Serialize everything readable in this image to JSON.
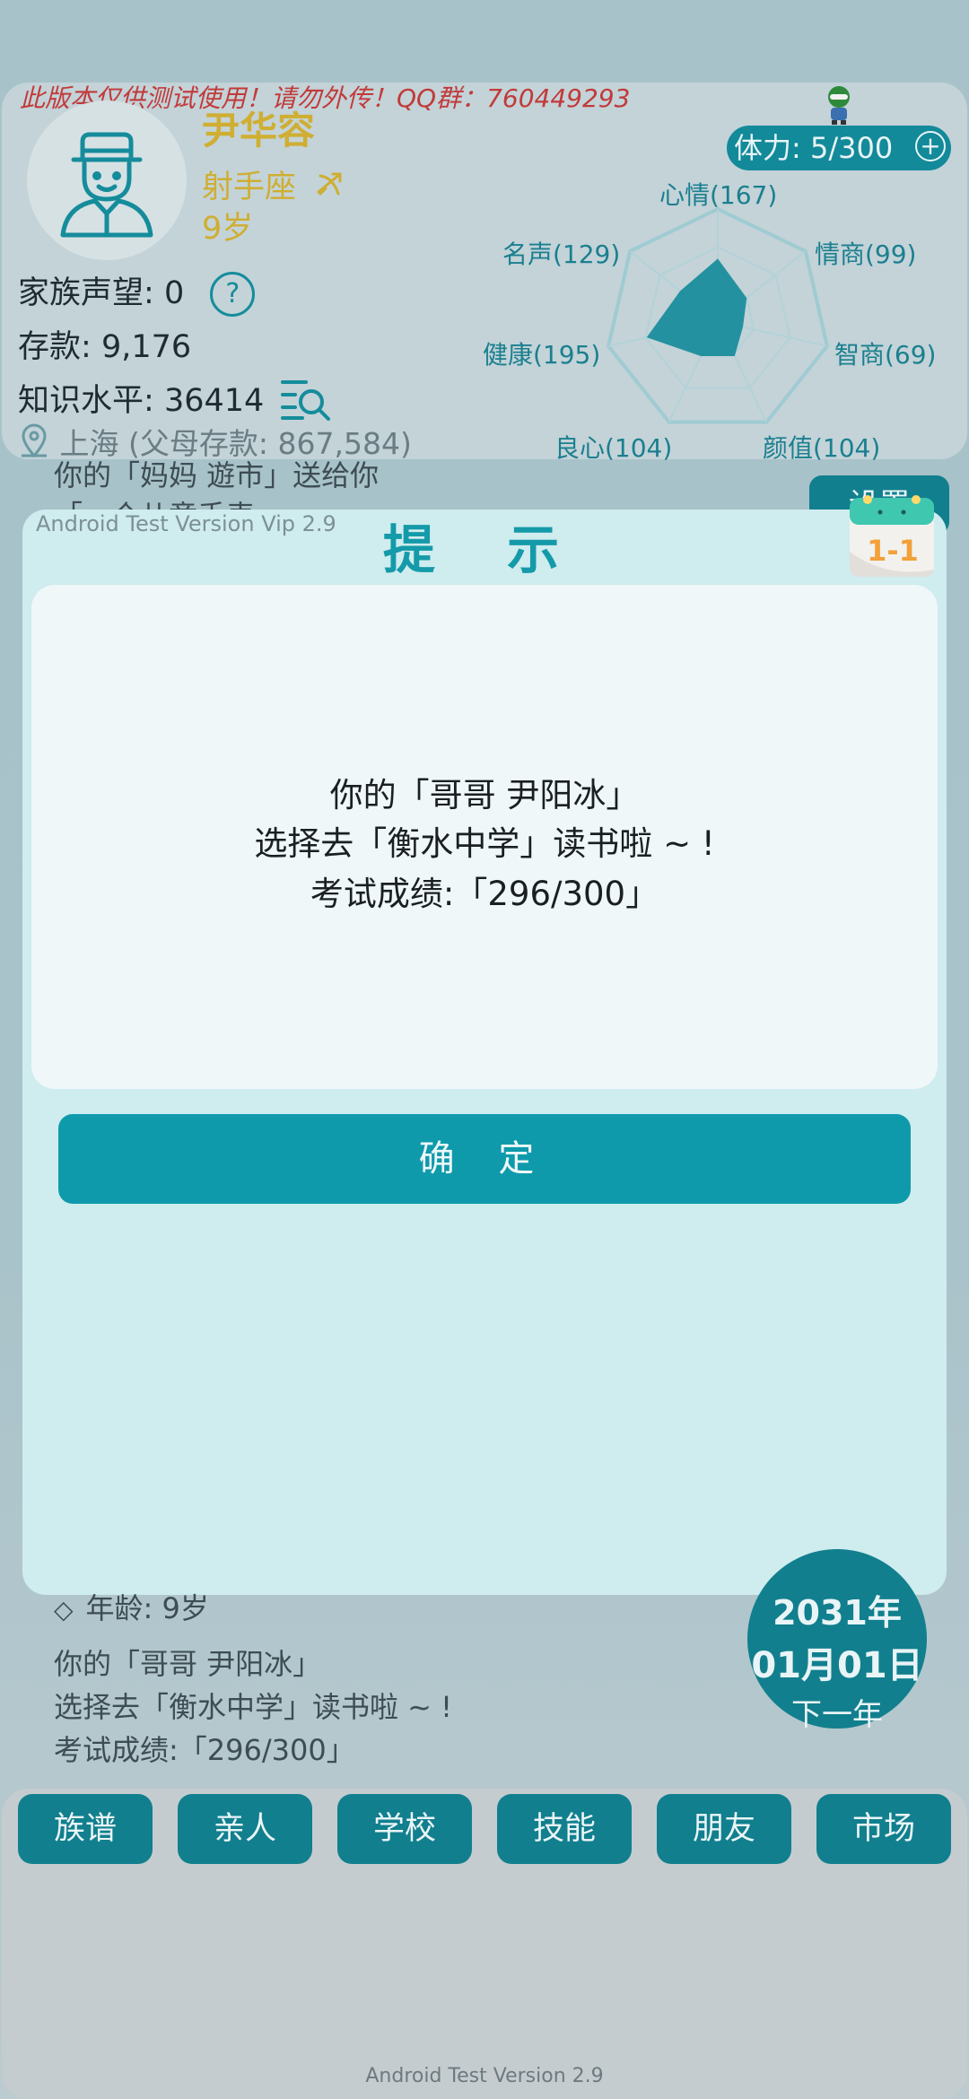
{
  "watermark": "此版本仅供测试使用！请勿外传！QQ群：760449293",
  "profile": {
    "name": "尹华容",
    "zodiac": "射手座",
    "age": "9岁"
  },
  "stats": {
    "reputation_label": "家族声望:",
    "reputation_value": "0",
    "savings_label": "存款:",
    "savings_value": "9,176",
    "knowledge_label": "知识水平:",
    "knowledge_value": "36414",
    "location": "上海",
    "parent_savings": "(父母存款: 867,584)"
  },
  "stamina": {
    "label": "体力: 5/300",
    "plus_icon": "plus-circle-icon"
  },
  "radar": {
    "labels": {
      "mood": "心情(167)",
      "eq": "情商(99)",
      "iq": "智商(69)",
      "looks": "颜值(104)",
      "conscience": "良心(104)",
      "health": "健康(195)",
      "fame": "名声(129)"
    },
    "values": {
      "mood": 167,
      "eq": 99,
      "iq": 69,
      "looks": 104,
      "conscience": 104,
      "health": 195,
      "fame": 129
    },
    "fill_color": "#138a9a"
  },
  "background_log": {
    "line1": "你的「妈妈 遊市」送给你",
    "line2": "「一个儿童手表」"
  },
  "settings_button": "设置",
  "dialog": {
    "version": "Android Test Version Vip 2.9",
    "title": "提 示",
    "calendar_badge": "1-1",
    "message": {
      "line1": "你的「哥哥 尹阳冰」",
      "line2": "选择去「衡水中学」读书啦 ~ !",
      "line3": "考试成绩:「296/300」"
    },
    "confirm": "确 定"
  },
  "log_below": {
    "age_line": "年龄: 9岁",
    "line1": "你的「哥哥 尹阳冰」",
    "line2": "选择去「衡水中学」读书啦 ~ !",
    "line3": "考试成绩:「296/300」"
  },
  "date_button": {
    "year": "2031年",
    "date": "01月01日",
    "action": "下一年"
  },
  "tabs": [
    "族谱",
    "亲人",
    "学校",
    "技能",
    "朋友",
    "市场"
  ],
  "footer": "Android Test Version 2.9",
  "colors": {
    "accent": "#117f8e",
    "gold": "#cfae32",
    "warning": "#c23a3a"
  }
}
